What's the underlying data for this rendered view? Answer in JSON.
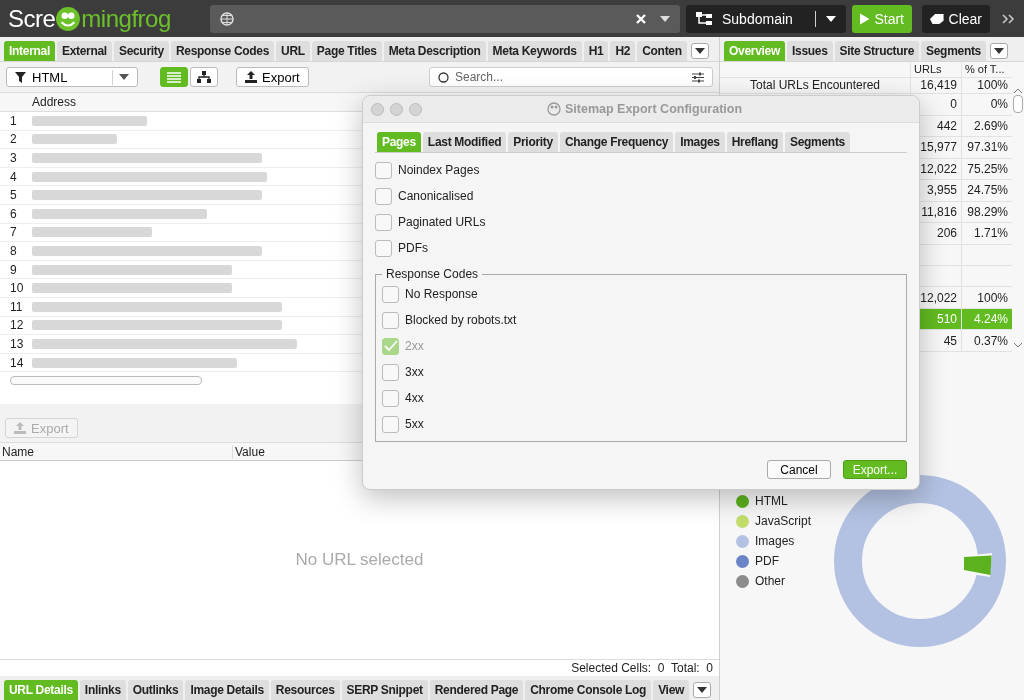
{
  "topbar": {
    "logo_start": "Scre",
    "logo_end": "mingfrog",
    "mode": "Subdomain",
    "start": "Start",
    "clear": "Clear"
  },
  "main_tabs": [
    {
      "label": "Internal",
      "selected": true
    },
    {
      "label": "External",
      "selected": false
    },
    {
      "label": "Security",
      "selected": false
    },
    {
      "label": "Response Codes",
      "selected": false
    },
    {
      "label": "URL",
      "selected": false
    },
    {
      "label": "Page Titles",
      "selected": false
    },
    {
      "label": "Meta Description",
      "selected": false
    },
    {
      "label": "Meta Keywords",
      "selected": false
    },
    {
      "label": "H1",
      "selected": false
    },
    {
      "label": "H2",
      "selected": false
    },
    {
      "label": "Conten",
      "selected": false
    }
  ],
  "toolbar": {
    "filter": "HTML",
    "views": [
      {
        "kind": "list",
        "selected": true
      },
      {
        "kind": "tree",
        "selected": false
      }
    ],
    "export": "Export",
    "search": {
      "placeholder": "Search..."
    }
  },
  "url_table": {
    "columns": [
      "Address"
    ],
    "rows": [
      "1",
      "2",
      "3",
      "4",
      "5",
      "6",
      "7",
      "8",
      "9",
      "10",
      "11",
      "12",
      "13",
      "14"
    ]
  },
  "detail": {
    "export": {
      "label": "Export",
      "disabled": true
    },
    "columns": [
      "Name",
      "Value"
    ],
    "empty": "No URL selected",
    "status": "Selected Cells:  0  Total:  0"
  },
  "bottom_tabs": [
    {
      "label": "URL Details",
      "selected": true
    },
    {
      "label": "Inlinks",
      "selected": false
    },
    {
      "label": "Outlinks",
      "selected": false
    },
    {
      "label": "Image Details",
      "selected": false
    },
    {
      "label": "Resources",
      "selected": false
    },
    {
      "label": "SERP Snippet",
      "selected": false
    },
    {
      "label": "Rendered Page",
      "selected": false
    },
    {
      "label": "Chrome Console Log",
      "selected": false
    },
    {
      "label": "View",
      "selected": false
    }
  ],
  "side_tabs": [
    {
      "label": "Overview",
      "selected": true
    },
    {
      "label": "Issues",
      "selected": false
    },
    {
      "label": "Site Structure",
      "selected": false
    },
    {
      "label": "Segments",
      "selected": false
    }
  ],
  "overview": {
    "columns": [
      "URLs",
      "% of T..."
    ],
    "rows": [
      {
        "label": "Total URLs Encountered",
        "urls": "16,419",
        "share": "100%",
        "selected": false
      },
      {
        "urls": "0",
        "share": "0%",
        "selected": false
      },
      {
        "urls": "442",
        "share": "2.69%",
        "selected": false
      },
      {
        "urls": "15,977",
        "share": "97.31%",
        "selected": false
      },
      {
        "urls": "12,022",
        "share": "75.25%",
        "selected": false
      },
      {
        "urls": "3,955",
        "share": "24.75%",
        "selected": false
      },
      {
        "urls": "11,816",
        "share": "98.29%",
        "selected": false
      },
      {
        "urls": "206",
        "share": "1.71%",
        "selected": false
      },
      {
        "selected": false
      },
      {
        "selected": false
      },
      {
        "urls": "12,022",
        "share": "100%",
        "selected": false
      },
      {
        "urls": "510",
        "share": "4.24%",
        "selected": true
      },
      {
        "urls": "45",
        "share": "0.37%",
        "selected": false
      }
    ]
  },
  "legend": [
    {
      "label": "HTML",
      "color": "#5cb21e"
    },
    {
      "label": "JavaScript",
      "color": "#c3de6b"
    },
    {
      "label": "Images",
      "color": "#b3c2e2"
    },
    {
      "label": "PDF",
      "color": "#6b84c8"
    },
    {
      "label": "Other",
      "color": "#8c8c8c"
    }
  ],
  "dialog": {
    "title": "Sitemap Export Configuration",
    "tabs": [
      {
        "label": "Pages",
        "selected": true
      },
      {
        "label": "Last Modified",
        "selected": false
      },
      {
        "label": "Priority",
        "selected": false
      },
      {
        "label": "Change Frequency",
        "selected": false
      },
      {
        "label": "Images",
        "selected": false
      },
      {
        "label": "Hreflang",
        "selected": false
      },
      {
        "label": "Segments",
        "selected": false
      }
    ],
    "options": [
      {
        "label": "Noindex Pages",
        "checked": false,
        "disabled": false
      },
      {
        "label": "Canonicalised",
        "checked": false,
        "disabled": false
      },
      {
        "label": "Paginated URLs",
        "checked": false,
        "disabled": false
      },
      {
        "label": "PDFs",
        "checked": false,
        "disabled": false
      }
    ],
    "group": {
      "title": "Response Codes",
      "options": [
        {
          "label": "No Response",
          "checked": false,
          "disabled": false
        },
        {
          "label": "Blocked by robots.txt",
          "checked": false,
          "disabled": false
        },
        {
          "label": "2xx",
          "checked": true,
          "disabled": true
        },
        {
          "label": "3xx",
          "checked": false,
          "disabled": false
        },
        {
          "label": "4xx",
          "checked": false,
          "disabled": false
        },
        {
          "label": "5xx",
          "checked": false,
          "disabled": false
        }
      ]
    },
    "buttons": [
      {
        "label": "Cancel",
        "kind": "secondary"
      },
      {
        "label": "Export...",
        "kind": "primary"
      }
    ]
  }
}
